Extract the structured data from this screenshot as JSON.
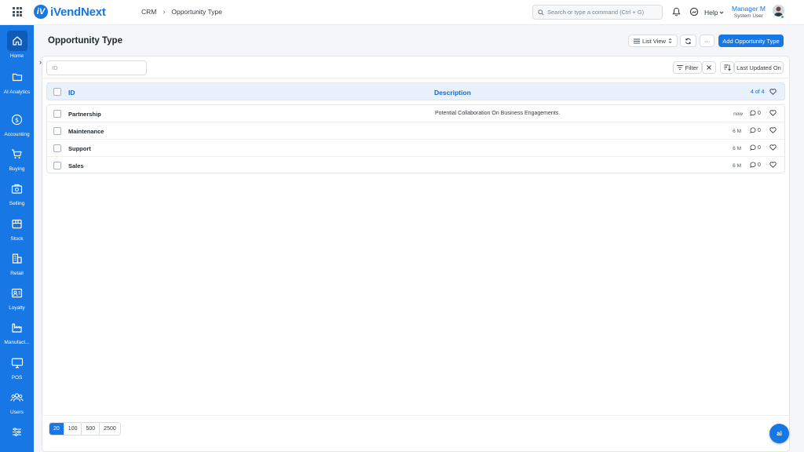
{
  "topbar": {
    "logo_mark": "iV",
    "logo_text": "iVendNext",
    "breadcrumb": [
      "CRM",
      "Opportunity Type"
    ],
    "search_placeholder": "Search or type a command (Ctrl + G)",
    "help_label": "Help",
    "user_name": "Manager M",
    "user_role": "System User"
  },
  "sidebar": {
    "items": [
      {
        "label": "Home",
        "icon": "home-icon"
      },
      {
        "label": "AI Analytics",
        "icon": "folder-icon"
      },
      {
        "label": "Accounting",
        "icon": "dollar-icon"
      },
      {
        "label": "Buying",
        "icon": "cart-icon"
      },
      {
        "label": "Selling",
        "icon": "selling-icon"
      },
      {
        "label": "Stock",
        "icon": "box-icon"
      },
      {
        "label": "Retail",
        "icon": "retail-icon"
      },
      {
        "label": "Loyalty",
        "icon": "loyalty-icon"
      },
      {
        "label": "Manufact...",
        "icon": "factory-icon"
      },
      {
        "label": "POS",
        "icon": "monitor-icon"
      },
      {
        "label": "Users",
        "icon": "users-icon"
      },
      {
        "label": "",
        "icon": "sliders-icon"
      }
    ]
  },
  "page": {
    "title": "Opportunity Type",
    "list_view_label": "List View",
    "more_label": "···",
    "add_button": "Add Opportunity Type",
    "id_filter_placeholder": "ID",
    "filter_label": "Filter",
    "sort_label": "Last Updated On"
  },
  "list": {
    "columns": {
      "id": "ID",
      "description": "Description"
    },
    "count": "4 of 4",
    "rows": [
      {
        "id": "Partnership",
        "description": "Potential Collaboration On Business Engagements.",
        "updated": "now",
        "comments": "0"
      },
      {
        "id": "Maintenance",
        "description": "",
        "updated": "6 M",
        "comments": "0"
      },
      {
        "id": "Support",
        "description": "",
        "updated": "6 M",
        "comments": "0"
      },
      {
        "id": "Sales",
        "description": "",
        "updated": "6 M",
        "comments": "0"
      }
    ]
  },
  "pager": {
    "sizes": [
      "20",
      "100",
      "500",
      "2500"
    ],
    "selected": "20"
  },
  "ai_button": "ai",
  "colors": {
    "accent": "#1677e5",
    "sidebar": "#1677e5",
    "header_row": "#e8f1fc"
  }
}
